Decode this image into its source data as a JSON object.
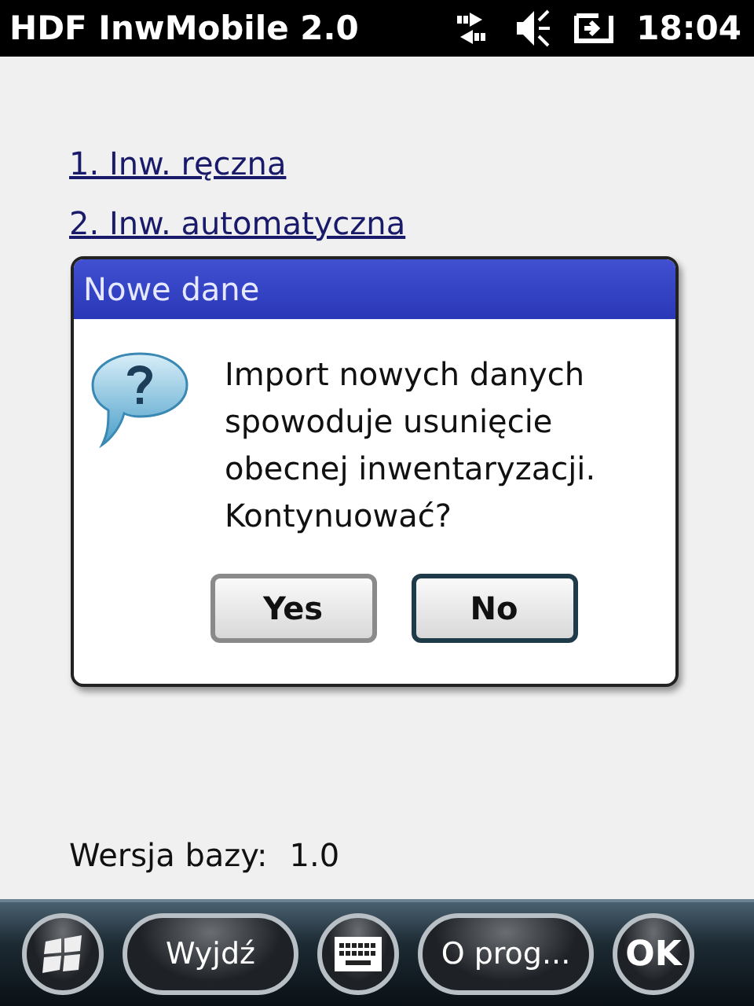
{
  "status_bar": {
    "title": "HDF InwMobile 2.0",
    "time": "18:04"
  },
  "menu_links": [
    "1. Inw. ręczna",
    "2. Inw. automatyczna"
  ],
  "version": {
    "label": "Wersja bazy:",
    "value": "1.0"
  },
  "dialog": {
    "title": "Nowe dane",
    "message": "Import nowych danych spowoduje usunięcie obecnej inwentaryzacji. Kontynuować?",
    "buttons": [
      {
        "label": "Yes",
        "focused": false
      },
      {
        "label": "No",
        "focused": true
      }
    ]
  },
  "softkeys": [
    {
      "kind": "start"
    },
    {
      "kind": "text",
      "label": "Wyjdź"
    },
    {
      "kind": "keyboard"
    },
    {
      "kind": "text",
      "label": "O prog..."
    },
    {
      "kind": "text-round",
      "label": "OK"
    }
  ]
}
